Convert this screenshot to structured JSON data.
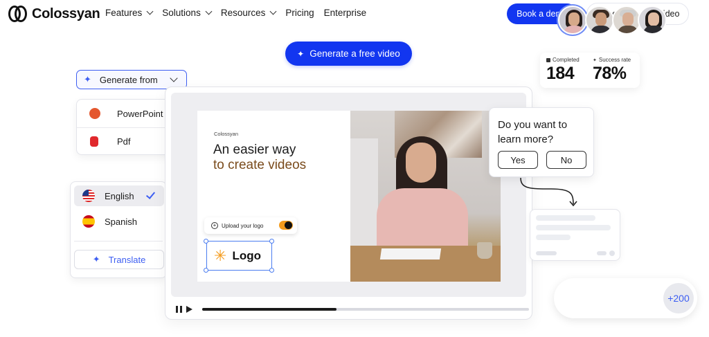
{
  "header": {
    "brand": "Colossyan",
    "nav": [
      {
        "label": "Features",
        "dropdown": true
      },
      {
        "label": "Solutions",
        "dropdown": true
      },
      {
        "label": "Resources",
        "dropdown": true
      },
      {
        "label": "Pricing",
        "dropdown": false
      },
      {
        "label": "Enterprise",
        "dropdown": false
      }
    ],
    "book_demo": "Book a demo",
    "generate_free": "Generate a free video"
  },
  "hero": {
    "cta": "Generate a free video"
  },
  "generate_from": {
    "label": "Generate from",
    "options": [
      {
        "label": "PowerPoint",
        "icon": "powerpoint-icon"
      },
      {
        "label": "Pdf",
        "icon": "pdf-icon"
      }
    ]
  },
  "languages": {
    "items": [
      {
        "label": "English",
        "flag": "us-flag-icon",
        "selected": true
      },
      {
        "label": "Spanish",
        "flag": "spain-flag-icon",
        "selected": false
      }
    ],
    "translate": "Translate"
  },
  "slide": {
    "brand": "Colossyan",
    "headline_line1": "An easier way",
    "headline_line2": "to create videos",
    "upload_logo": "Upload your logo",
    "logo_label": "Logo"
  },
  "player": {
    "progress": 0.41
  },
  "stats": {
    "completed_label": "Completed",
    "completed_value": "184",
    "success_label": "Success rate",
    "success_value": "78%"
  },
  "question": {
    "text_line1": "Do you want to",
    "text_line2": "learn more?",
    "yes": "Yes",
    "no": "No"
  },
  "avatars": {
    "more_count": "+200"
  },
  "colors": {
    "accent": "#1236f0",
    "accent_light": "#3d5ef2",
    "orange": "#f49b1c",
    "headline_brown": "#7a4b1c"
  }
}
